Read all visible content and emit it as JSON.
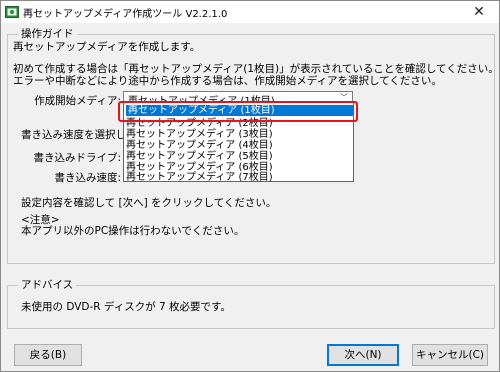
{
  "window": {
    "title": "再セットアップメディア作成ツール V2.2.1.0",
    "close_label": "✕"
  },
  "guide": {
    "section_title": "操作ガイド",
    "intro": "再セットアップメディアを作成します。",
    "line1": "初めて作成する場合は「再セットアップメディア(1枚目)」が表示されていることを確認してください。",
    "line2": "エラーや中断などにより途中から作成する場合は、作成開始メディアを選択してください。",
    "start_media_label": "作成開始メディア:",
    "start_media_value": "再セットアップメディア (1枚目)",
    "speed_prompt": "書き込み速度を選択して",
    "drive_label": "書き込みドライブ:",
    "speed_label": "書き込み速度:",
    "confirm": "設定内容を確認して [次へ] をクリックしてください。",
    "note_title": "<注意>",
    "note_body": "本アプリ以外のPC操作は行わないでください。"
  },
  "dropdown_options": [
    "再セットアップメディア (1枚目)",
    "再セットアップメディア (2枚目)",
    "再セットアップメディア (3枚目)",
    "再セットアップメディア (4枚目)",
    "再セットアップメディア (5枚目)",
    "再セットアップメディア (6枚目)",
    "再セットアップメディア (7枚目)"
  ],
  "advice": {
    "section_title": "アドバイス",
    "text": "未使用の DVD-R ディスクが 7 枚必要です。"
  },
  "buttons": {
    "back": "戻る(B)",
    "next": "次へ(N)",
    "cancel": "キャンセル(C)"
  },
  "colors": {
    "highlight": "#0078d7",
    "callout": "#e5141e"
  }
}
